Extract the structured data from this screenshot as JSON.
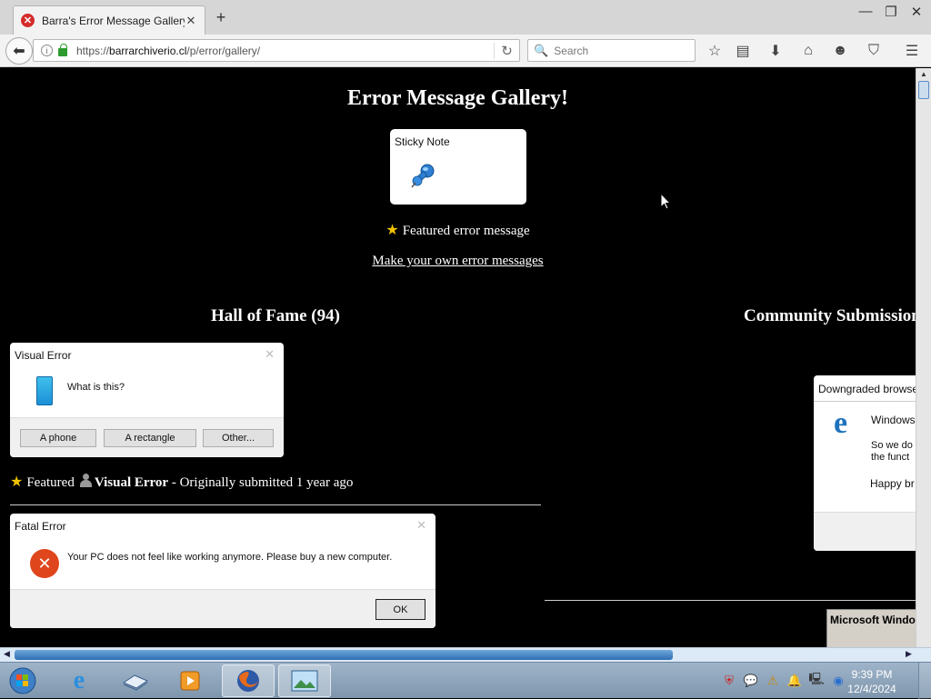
{
  "browser": {
    "tab_title": "Barra's Error Message Gallery",
    "tab_favicon": "x-circle-icon",
    "new_tab": "+",
    "url_prefix": "https://",
    "url_domain": "barrarchiverio.cl",
    "url_path": "/p/error/gallery/",
    "search_placeholder": "Search",
    "window_controls": {
      "minimize": "—",
      "restore": "❐",
      "close": "✕"
    }
  },
  "page": {
    "title": "Error Message Gallery!",
    "sticky_note": {
      "title": "Sticky Note",
      "icon": "pushpin-icon"
    },
    "featured_label": "Featured error message",
    "make_link": "Make your own error messages",
    "hall_of_fame": "Hall of Fame (94)",
    "community": "Community Submission",
    "visual_error": {
      "title": "Visual Error",
      "message": "What is this?",
      "buttons": [
        "A phone",
        "A rectangle",
        "Other..."
      ]
    },
    "entry_meta": {
      "featured": "Featured",
      "name": "Visual Error",
      "suffix": "- Originally submitted 1 year ago"
    },
    "fatal_error": {
      "title": "Fatal Error",
      "message": "Your PC does not feel like working anymore. Please buy a new computer.",
      "ok": "OK"
    },
    "downgraded": {
      "title": "Downgraded browse",
      "line1": "Windows",
      "line2": "So we do",
      "line3": "the funct",
      "line4": "Happy br"
    },
    "ms_windows": "Microsoft Windo"
  },
  "taskbar": {
    "time": "9:39 PM",
    "date": "12/4/2024"
  },
  "colors": {
    "page_bg": "#000000",
    "error_red": "#e0461c",
    "edge_blue": "#1e73be"
  }
}
